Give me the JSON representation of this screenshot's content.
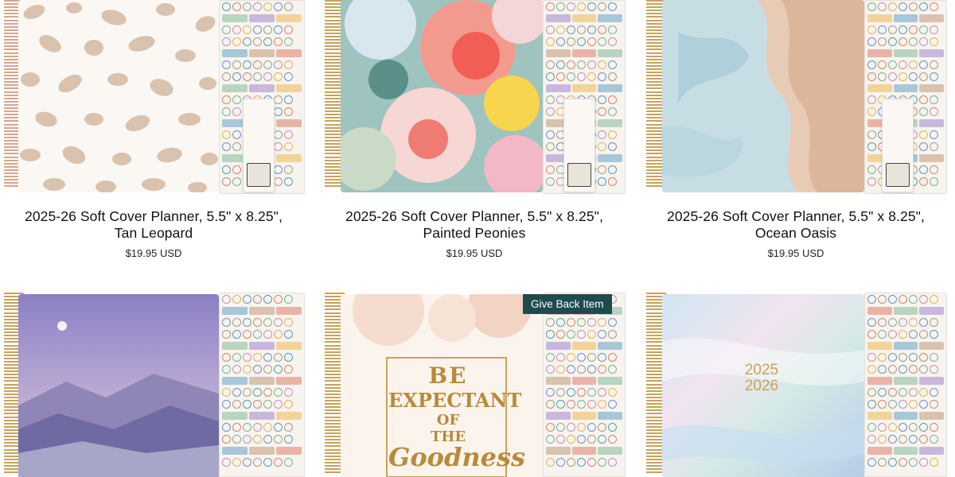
{
  "products": [
    {
      "title_line1": "2025-26 Soft Cover Planner, 5.5\" x 8.25\",",
      "title_line2": "Tan Leopard",
      "price": "$19.95 USD",
      "cover": "leopard"
    },
    {
      "title_line1": "2025-26 Soft Cover Planner, 5.5\" x 8.25\",",
      "title_line2": "Painted Peonies",
      "price": "$19.95 USD",
      "cover": "peonies"
    },
    {
      "title_line1": "2025-26 Soft Cover Planner, 5.5\" x 8.25\",",
      "title_line2": "Ocean Oasis",
      "price": "$19.95 USD",
      "cover": "ocean"
    },
    {
      "cover": "mountains"
    },
    {
      "cover": "expectant",
      "badge": "Give Back Item",
      "cover_lines": [
        "BE",
        "EXPECTANT",
        "OF",
        "THE",
        "Goodness"
      ]
    },
    {
      "cover": "holo",
      "cover_lines": [
        "2025",
        "2026"
      ]
    }
  ],
  "colors": {
    "badge_bg": "#1f4b4c",
    "spiral_gold": "#c9a25a",
    "spiral_rose": "#d7a58b"
  }
}
